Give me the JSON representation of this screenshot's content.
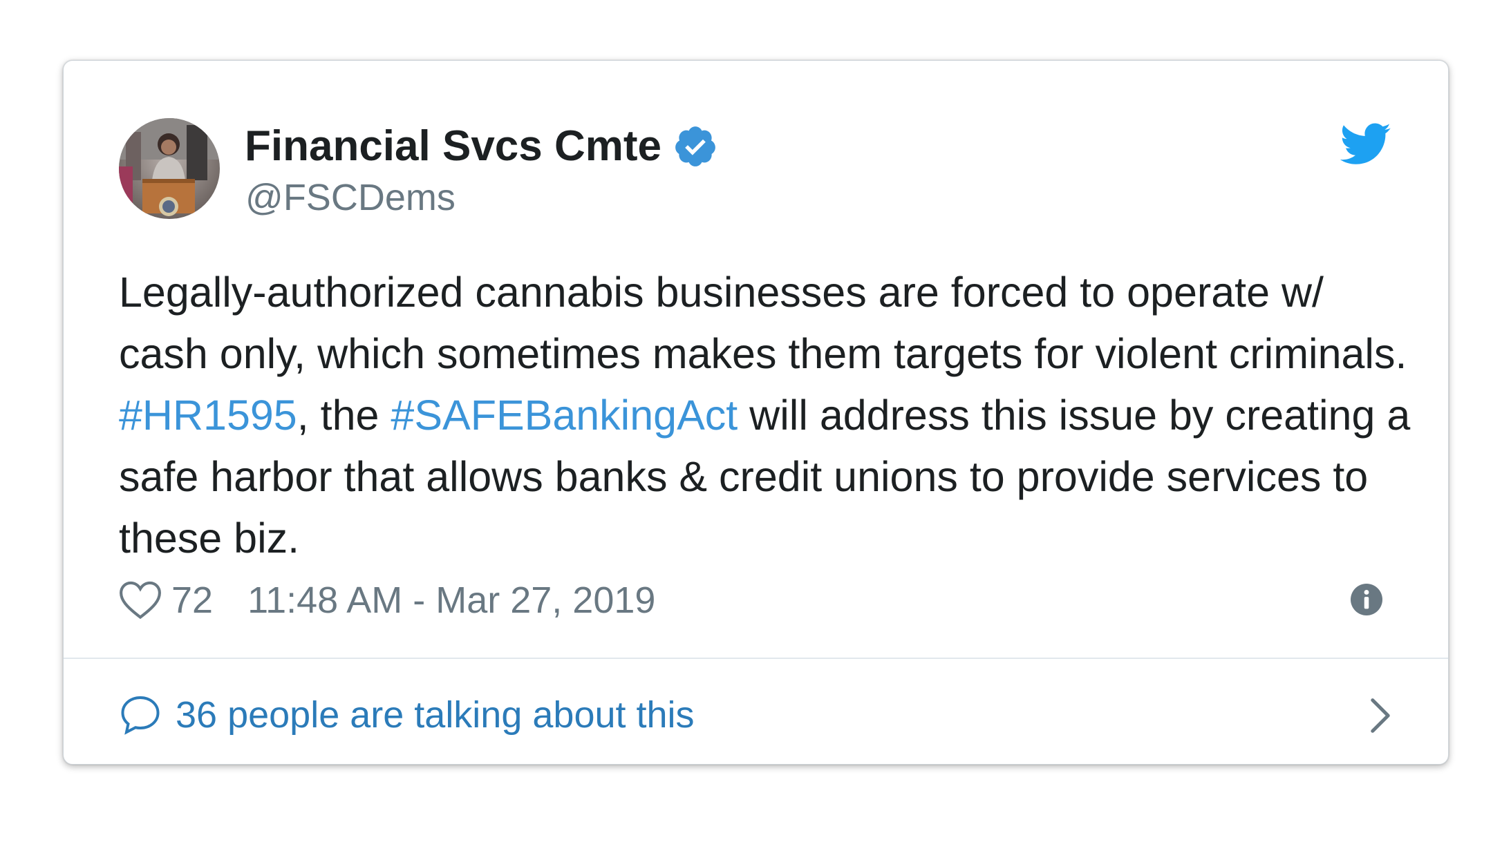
{
  "author": {
    "name": "Financial Svcs Cmte",
    "handle": "@FSCDems",
    "verified": true
  },
  "tweet": {
    "text_parts": [
      {
        "text": "Legally-authorized cannabis businesses are forced to operate w/ cash only, which sometimes makes them targets for violent criminals. ",
        "type": "text"
      },
      {
        "text": "#HR1595",
        "type": "hashtag"
      },
      {
        "text": ", the ",
        "type": "text"
      },
      {
        "text": "#SAFEBankingAct",
        "type": "hashtag"
      },
      {
        "text": " will address this issue by creating a safe harbor that allows banks & credit unions to provide services to these biz.",
        "type": "text"
      }
    ]
  },
  "meta": {
    "likes": "72",
    "timestamp": "11:48 AM - Mar 27, 2019"
  },
  "conversation": {
    "label": "36 people are talking about this"
  },
  "icons": {
    "brand": "twitter-bird-icon",
    "verified": "verified-badge-icon",
    "like": "heart-icon",
    "info": "info-icon",
    "reply": "speech-bubble-icon",
    "navigate": "chevron-right-icon"
  },
  "colors": {
    "brand_blue": "#1da1f2",
    "verified_blue": "#3b94d9",
    "hashtag_blue": "#3b94d9",
    "link_blue": "#2b7bb9",
    "text_primary": "#1c2022",
    "text_secondary": "#697882",
    "divider": "#e1e8ed"
  }
}
